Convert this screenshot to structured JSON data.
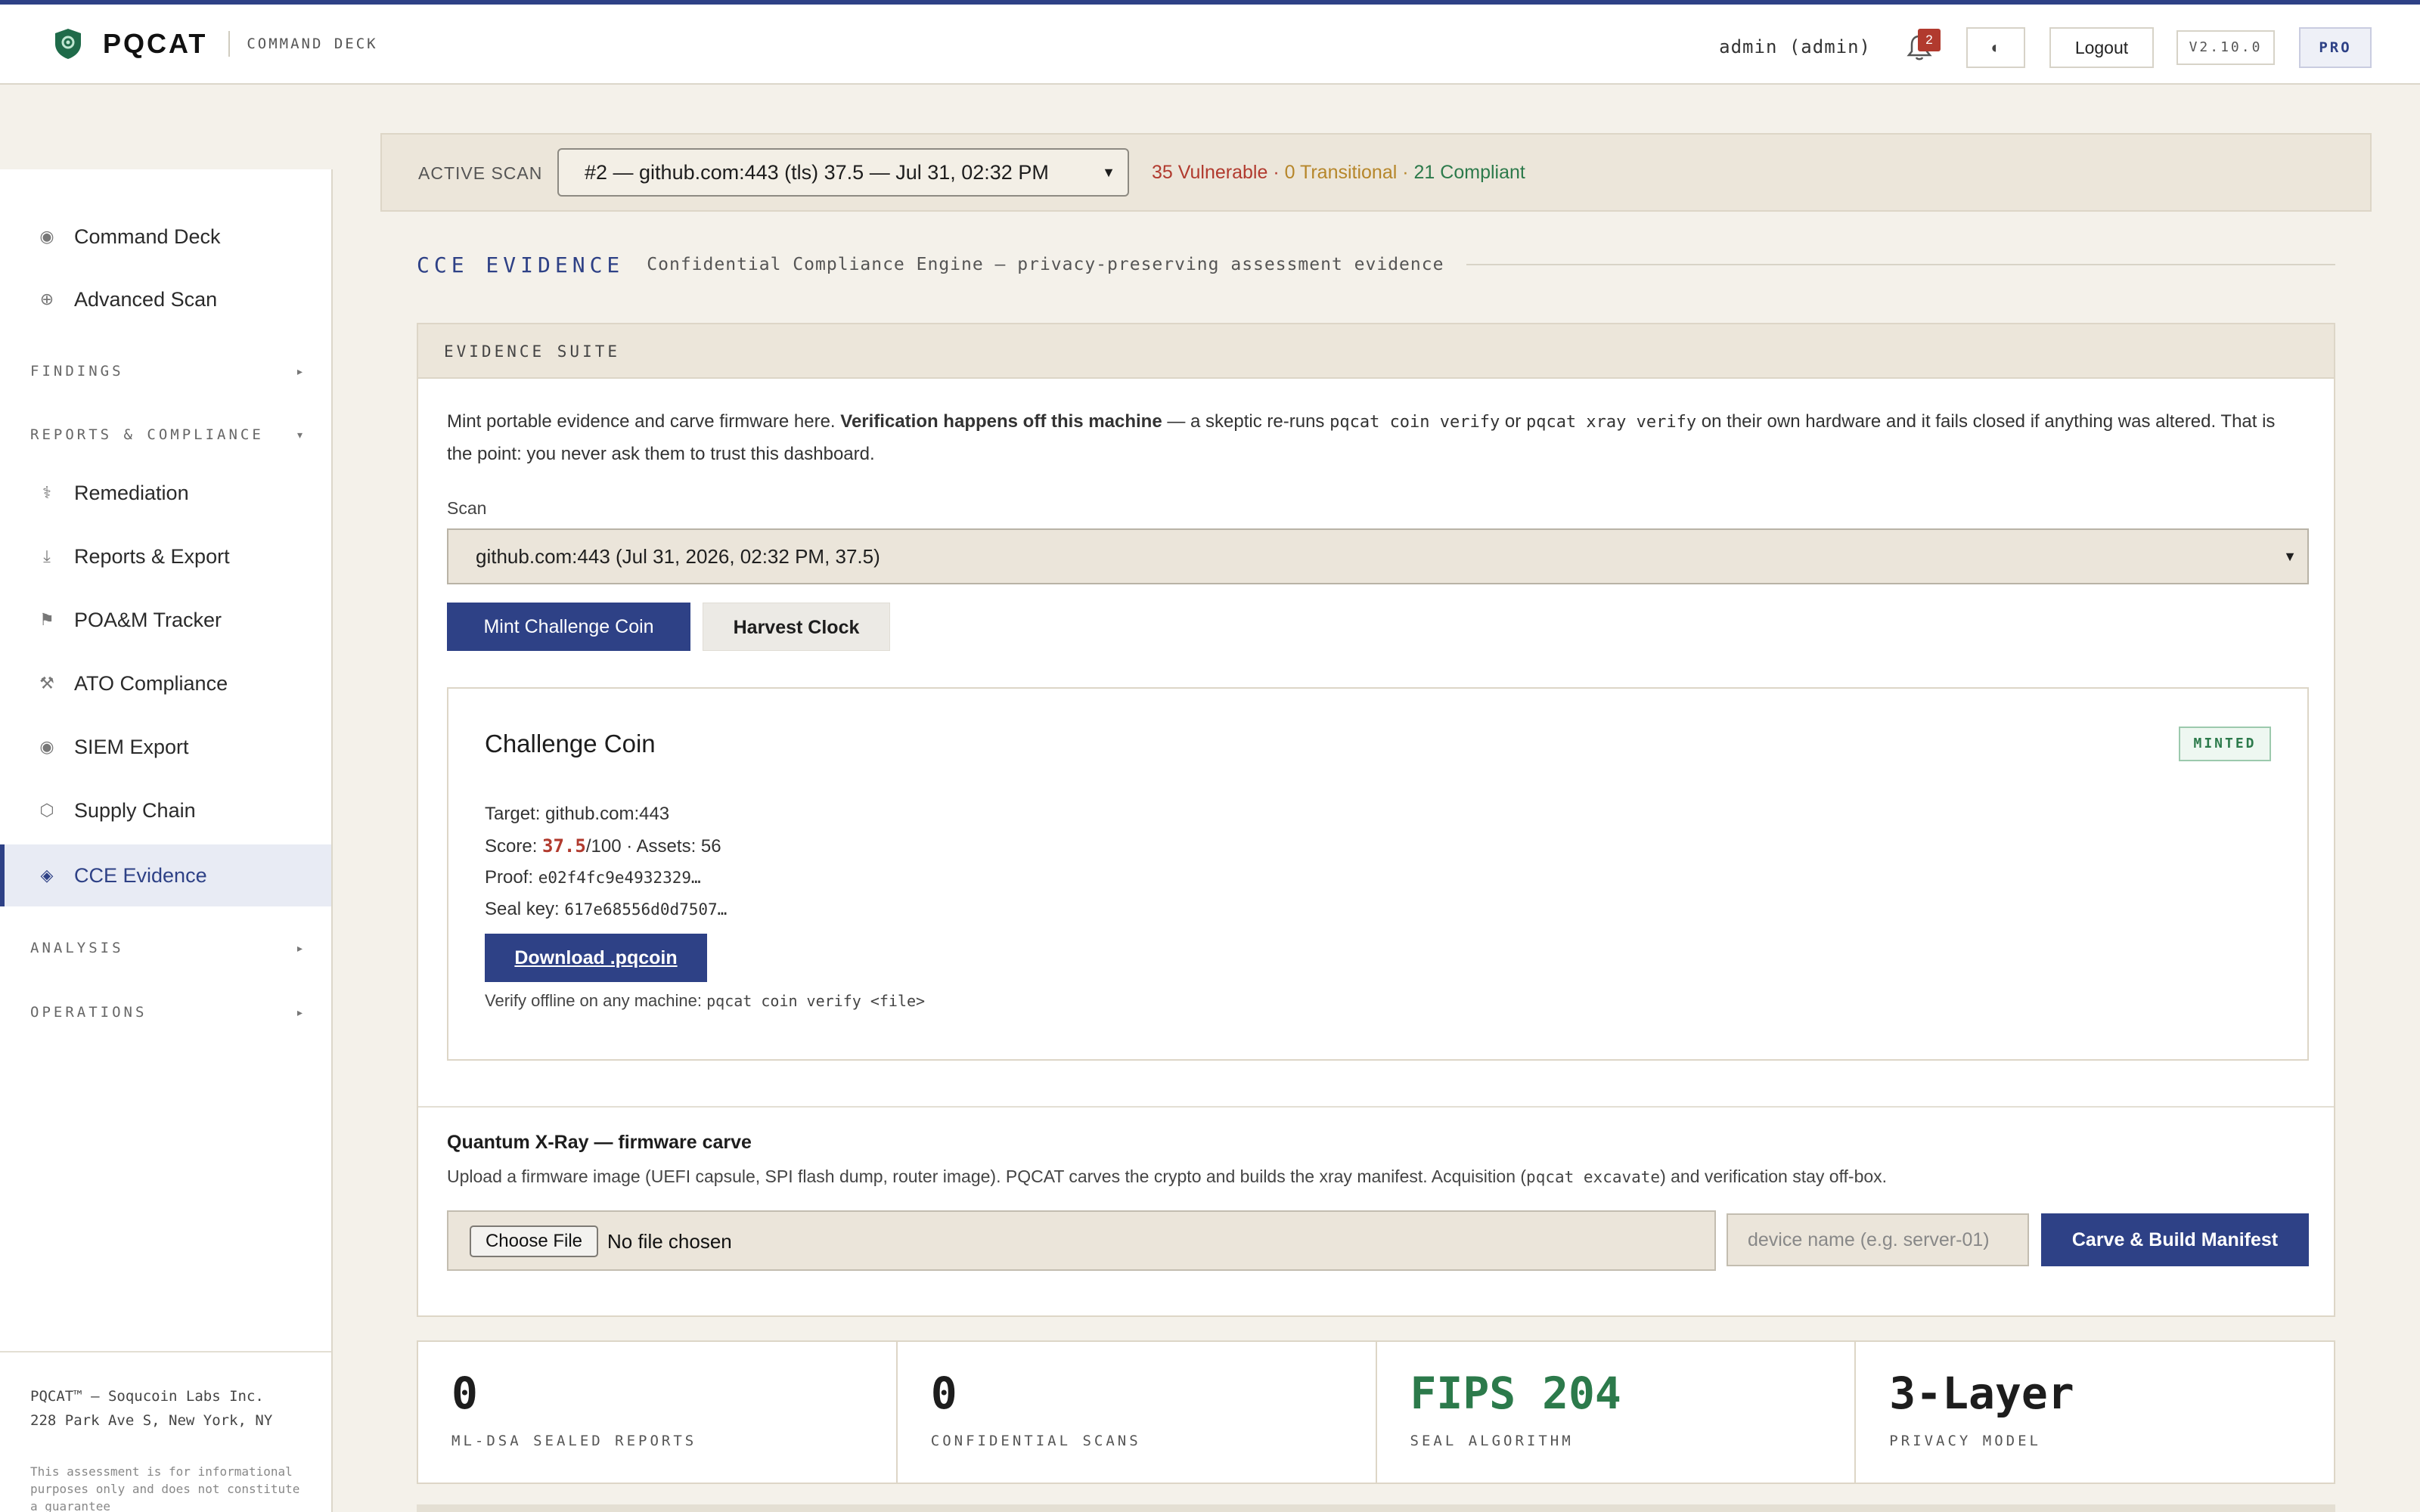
{
  "header": {
    "brand": "PQCAT",
    "subtitle": "COMMAND DECK",
    "user": "admin (admin)",
    "notifications": "2",
    "theme_icon": "◐",
    "logout": "Logout",
    "version": "V2.10.0",
    "plan": "PRO"
  },
  "sidebar": {
    "items": [
      {
        "icon": "◉",
        "label": "Command Deck"
      },
      {
        "icon": "⊕",
        "label": "Advanced Scan"
      },
      {
        "icon": "⚕",
        "label": "Remediation"
      },
      {
        "icon": "⤓",
        "label": "Reports & Export"
      },
      {
        "icon": "⚑",
        "label": "POA&M Tracker"
      },
      {
        "icon": "⚒",
        "label": "ATO Compliance"
      },
      {
        "icon": "◉",
        "label": "SIEM Export"
      },
      {
        "icon": "⬡",
        "label": "Supply Chain"
      },
      {
        "icon": "◈",
        "label": "CCE Evidence"
      }
    ],
    "sections": {
      "findings": "FINDINGS",
      "reports": "REPORTS & COMPLIANCE",
      "analysis": "ANALYSIS",
      "operations": "OPERATIONS"
    },
    "footer": {
      "company": "PQCAT™ — Soqucoin Labs Inc.",
      "address": "228 Park Ave S, New York, NY",
      "disclaimer": "This assessment is for informational purposes only and does not constitute a guarantee"
    }
  },
  "active_scan": {
    "label": "ACTIVE SCAN",
    "selected": "#2 — github.com:443 (tls) 37.5 — Jul 31, 02:32 PM",
    "vulnerable": "35 Vulnerable",
    "transitional": "0 Transitional",
    "compliant": "21 Compliant",
    "sep": "·"
  },
  "page": {
    "title": "CCE EVIDENCE",
    "description": "Confidential Compliance Engine — privacy-preserving assessment evidence"
  },
  "suite": {
    "header": "EVIDENCE SUITE",
    "intro": {
      "p1": "Mint portable evidence and carve firmware here. ",
      "bold": "Verification happens off this machine",
      "p2": " — a skeptic re-runs ",
      "code1": "pqcat coin verify",
      "p3": " or ",
      "code2": "pqcat xray verify",
      "p4": " on their own hardware and it fails closed if anything was altered. That is the point: you never ask them to trust this dashboard."
    },
    "scan_label": "Scan",
    "scan_value": "github.com:443 (Jul 31, 2026, 02:32 PM, 37.5)",
    "mint_button": "Mint Challenge Coin",
    "harvest_button": "Harvest Clock"
  },
  "coin": {
    "title": "Challenge Coin",
    "badge": "MINTED",
    "target": "Target: github.com:443",
    "score_prefix": "Score: ",
    "score": "37.5",
    "score_suffix": "/100 · Assets: 56",
    "proof_label": "Proof: ",
    "proof": "e02f4fc9e4932329…",
    "seal_label": "Seal key: ",
    "seal": "617e68556d0d7507…",
    "download": "Download .pqcoin",
    "verify_prefix": "Verify offline on any machine: ",
    "verify_cmd": "pqcat coin verify <file>"
  },
  "xray": {
    "title": "Quantum X-Ray — firmware carve",
    "desc1": "Upload a firmware image (UEFI capsule, SPI flash dump, router image). PQCAT carves the crypto and builds the xray manifest. Acquisition (",
    "desc_code": "pqcat excavate",
    "desc2": ") and verification stay off-box.",
    "choose": "Choose File",
    "no_file": "No file chosen",
    "device_placeholder": "device name (e.g. server-01)",
    "carve": "Carve & Build Manifest"
  },
  "stats": [
    {
      "value": "0",
      "label": "ML-DSA SEALED REPORTS"
    },
    {
      "value": "0",
      "label": "CONFIDENTIAL SCANS"
    },
    {
      "value": "FIPS 204",
      "label": "SEAL ALGORITHM"
    },
    {
      "value": "3-Layer",
      "label": "PRIVACY MODEL"
    }
  ],
  "colors": {
    "accent": "#2e4186",
    "vulnerable": "#b13a2e",
    "transitional": "#b6862a",
    "compliant": "#2c7a4b"
  }
}
